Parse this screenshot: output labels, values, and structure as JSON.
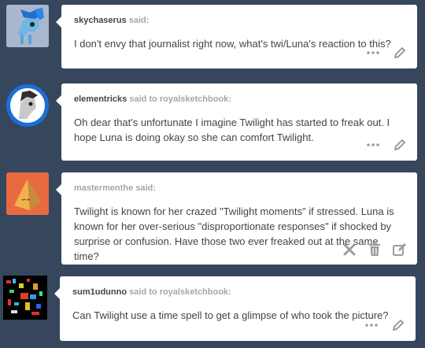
{
  "posts": [
    {
      "asker": "skychaserus",
      "said_text": "said:",
      "question": "I don't envy that journalist right now, what's twi/Luna's reaction to this?",
      "avatar_icon": "blue-pony-icon",
      "controls": [
        "more-icon",
        "edit-icon"
      ]
    },
    {
      "asker": "elementricks",
      "said_text": "said to royalsketchbook:",
      "question": "Oh dear that's unfortunate I imagine Twilight has started to freak out. I hope Luna is doing okay so she can comfort Twilight.",
      "avatar_icon": "grey-pony-icon",
      "controls": [
        "more-icon",
        "edit-icon"
      ]
    },
    {
      "asker": "mastermenthe",
      "said_text": "said:",
      "question": "Twilight is known for her crazed \"Twilight moments\" if stressed. Luna is known for her over-serious \"disproportionate responses\" if shocked by surprise or confusion. Have those two ever freaked out at the same time?",
      "avatar_icon": "pyramid-icon",
      "controls": [
        "delete-icon",
        "trash-icon",
        "edit-icon"
      ]
    },
    {
      "asker": "sum1udunno",
      "said_text": "said to royalsketchbook:",
      "question": "Can Twilight use a time spell to get a glimpse of who took the picture?",
      "avatar_icon": "pixel-art-icon",
      "controls": [
        "more-icon",
        "edit-icon"
      ]
    }
  ],
  "colors": {
    "background": "#36465d",
    "card": "#ffffff",
    "text": "#444444",
    "muted": "#a7a7a7",
    "controls": "#9c9c9c"
  }
}
